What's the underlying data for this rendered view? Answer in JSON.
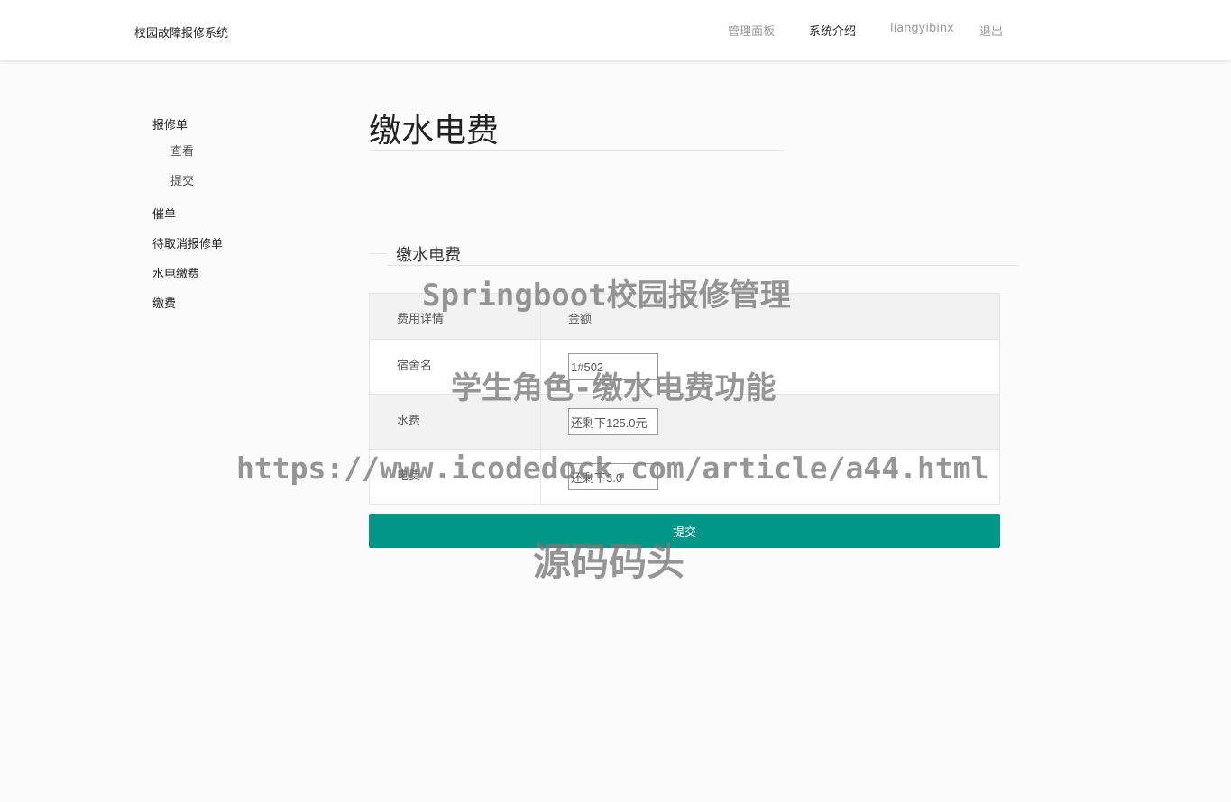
{
  "header": {
    "brand": "校园故障报修系统",
    "nav": [
      {
        "label": "管理面板",
        "active": false
      },
      {
        "label": "系统介绍",
        "active": true
      },
      {
        "label": "liangyibinx",
        "active": false
      },
      {
        "label": "退出",
        "active": false
      }
    ]
  },
  "sidebar": {
    "repair": "报修单",
    "repair_view": "查看",
    "repair_submit": "提交",
    "urge": "催单",
    "cancel_pending": "待取消报修单",
    "utility_pay": "水电缴费",
    "pay": "缴费"
  },
  "main": {
    "title": "缴水电费",
    "section_legend": "缴水电费",
    "table": {
      "headers": [
        "费用详情",
        "金额"
      ],
      "rows": [
        {
          "label": "宿舍名",
          "value": "1#502"
        },
        {
          "label": "水费",
          "value": "还剩下125.0元"
        },
        {
          "label": "电费",
          "value": "还剩下3.0"
        }
      ]
    },
    "submit_label": "提交"
  },
  "watermarks": {
    "line1": "Springboot校园报修管理",
    "line2": "学生角色-缴水电费功能",
    "line3": "https://www.icodedock.com/article/a44.html",
    "line4": "源码码头"
  },
  "colors": {
    "accent": "#009688",
    "nav_active": "#222222",
    "nav_inactive": "#999999"
  }
}
